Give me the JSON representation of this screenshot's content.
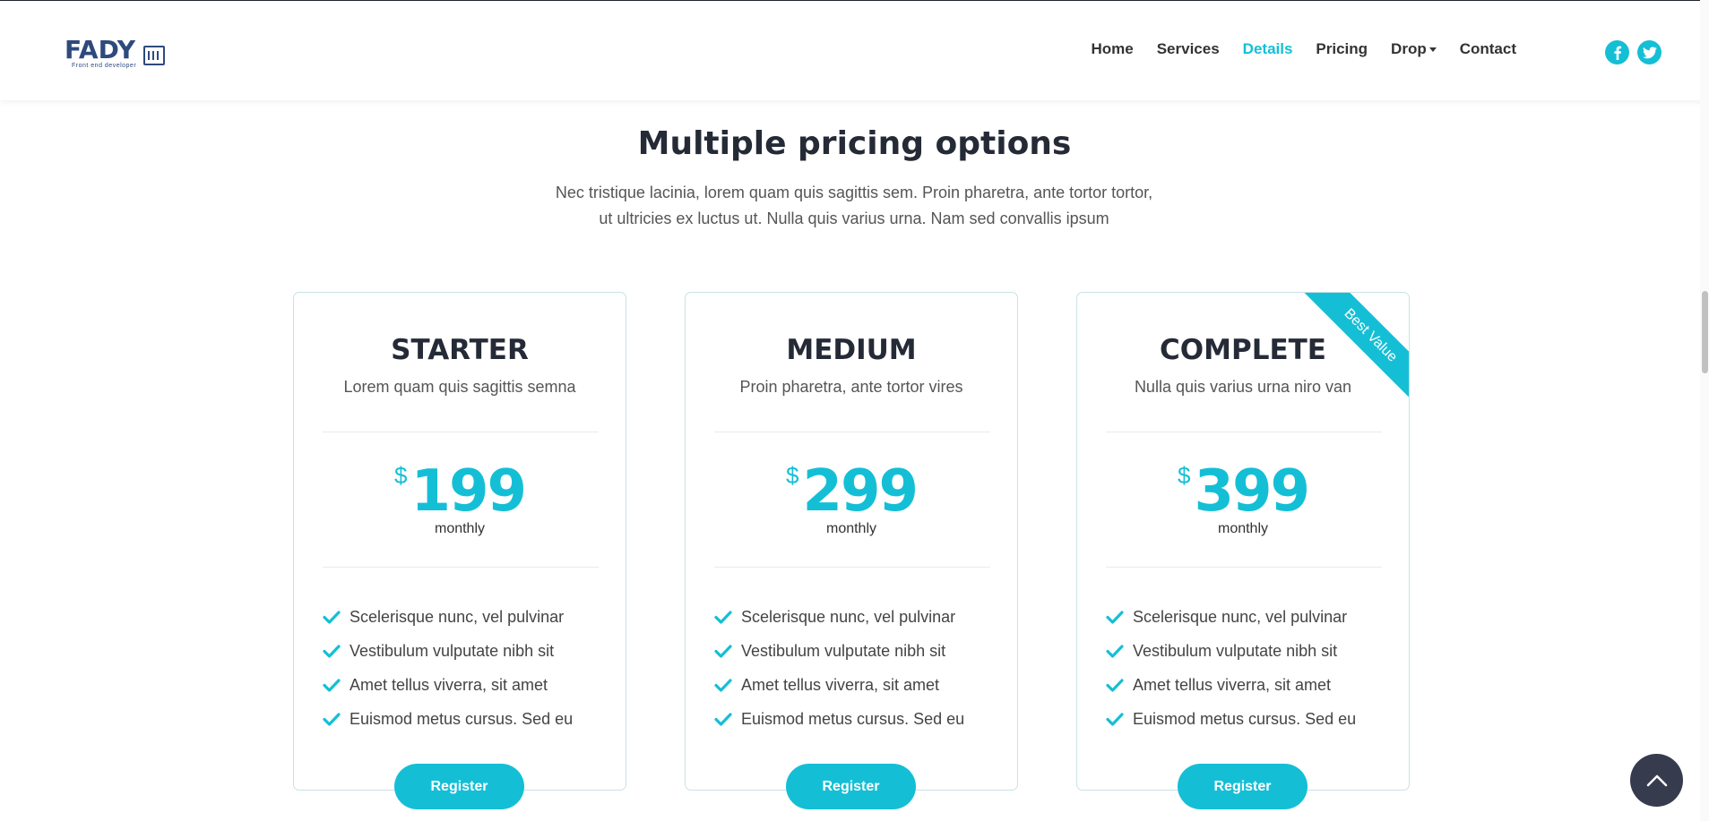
{
  "brand": {
    "name": "FADY",
    "tagline": "Front end developer"
  },
  "nav": {
    "items": [
      {
        "label": "Home",
        "active": false
      },
      {
        "label": "Services",
        "active": false
      },
      {
        "label": "Details",
        "active": true
      },
      {
        "label": "Pricing",
        "active": false
      },
      {
        "label": "Drop",
        "active": false,
        "dropdown": true
      },
      {
        "label": "Contact",
        "active": false
      }
    ],
    "social": [
      {
        "icon": "facebook-icon",
        "glyph": "f"
      },
      {
        "icon": "twitter-icon",
        "glyph": "t"
      }
    ]
  },
  "section": {
    "title": "Multiple pricing options",
    "description_line1": "Nec tristique lacinia, lorem quam quis sagittis sem. Proin pharetra, ante tortor tortor,",
    "description_line2": "ut ultricies ex luctus ut. Nulla quis varius urna. Nam sed convallis ipsum"
  },
  "plans": [
    {
      "name": "STARTER",
      "subtitle": "Lorem quam quis sagittis semna",
      "currency": "$",
      "price": "199",
      "period": "monthly",
      "features": [
        "Scelerisque nunc, vel pulvinar",
        "Vestibulum vulputate nibh sit",
        "Amet tellus viverra, sit amet",
        "Euismod metus cursus. Sed eu"
      ],
      "button": "Register"
    },
    {
      "name": "MEDIUM",
      "subtitle": "Proin pharetra, ante tortor vires",
      "currency": "$",
      "price": "299",
      "period": "monthly",
      "features": [
        "Scelerisque nunc, vel pulvinar",
        "Vestibulum vulputate nibh sit",
        "Amet tellus viverra, sit amet",
        "Euismod metus cursus. Sed eu"
      ],
      "button": "Register"
    },
    {
      "name": "COMPLETE",
      "subtitle": "Nulla quis varius urna niro van",
      "currency": "$",
      "price": "399",
      "period": "monthly",
      "ribbon": "Best Value",
      "features": [
        "Scelerisque nunc, vel pulvinar",
        "Vestibulum vulputate nibh sit",
        "Amet tellus viverra, sit amet",
        "Euismod metus cursus. Sed eu"
      ],
      "button": "Register"
    }
  ],
  "colors": {
    "accent": "#14bfd6",
    "heading": "#252a37",
    "brand": "#2e4a7d",
    "back_to_top": "#363b4e"
  },
  "icons": {
    "feature": "check-icon",
    "back_to_top": "chevron-up-icon"
  }
}
